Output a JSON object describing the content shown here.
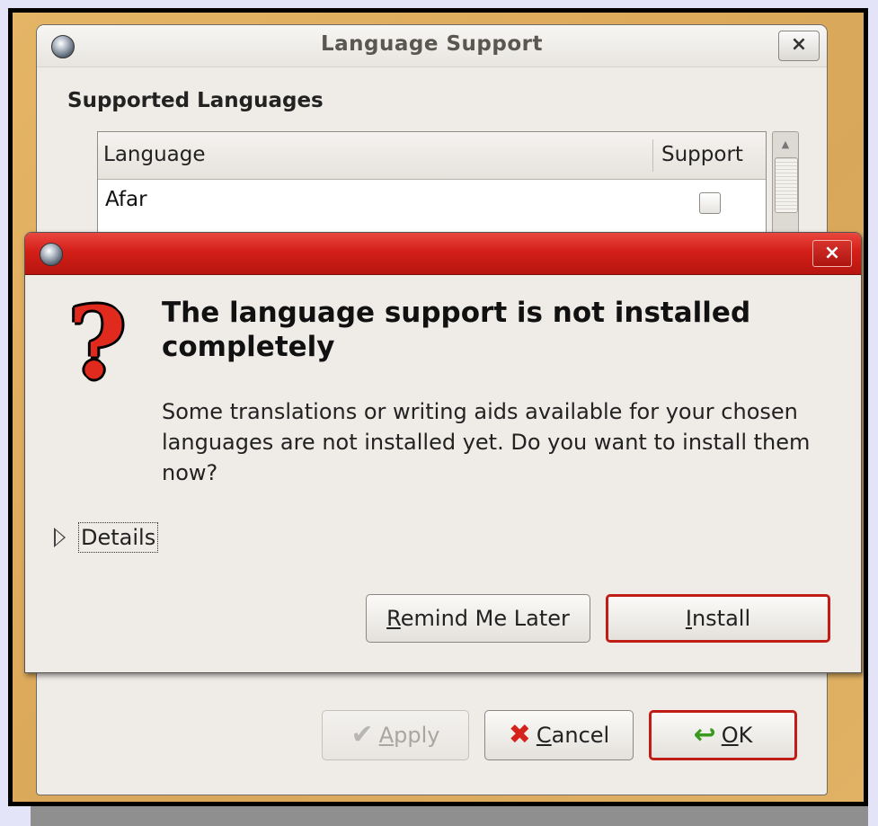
{
  "back_window": {
    "title": "Language Support",
    "close_label": "×",
    "section_title": "Supported Languages",
    "table": {
      "columns": [
        "Language",
        "Support"
      ],
      "rows": [
        {
          "language": "Afar",
          "support": false
        }
      ]
    },
    "buttons": {
      "apply": {
        "mnemonic": "A",
        "rest": "pply"
      },
      "cancel": {
        "mnemonic": "C",
        "rest": "ancel"
      },
      "ok": {
        "mnemonic": "O",
        "rest": "K"
      }
    }
  },
  "dialog": {
    "close_label": "×",
    "icon": "question-mark",
    "headline": "The language support is not installed completely",
    "body": "Some translations or writing aids available for your chosen languages are not installed yet. Do you want to install them now?",
    "details_label": "Details",
    "buttons": {
      "remind": {
        "mnemonic": "R",
        "rest": "emind Me Later"
      },
      "install": {
        "mnemonic": "I",
        "rest": "nstall"
      }
    }
  },
  "colors": {
    "dialog_titlebar": "#d41f18",
    "default_button_border": "#c11d17",
    "desktop": "#dcaa5a"
  }
}
